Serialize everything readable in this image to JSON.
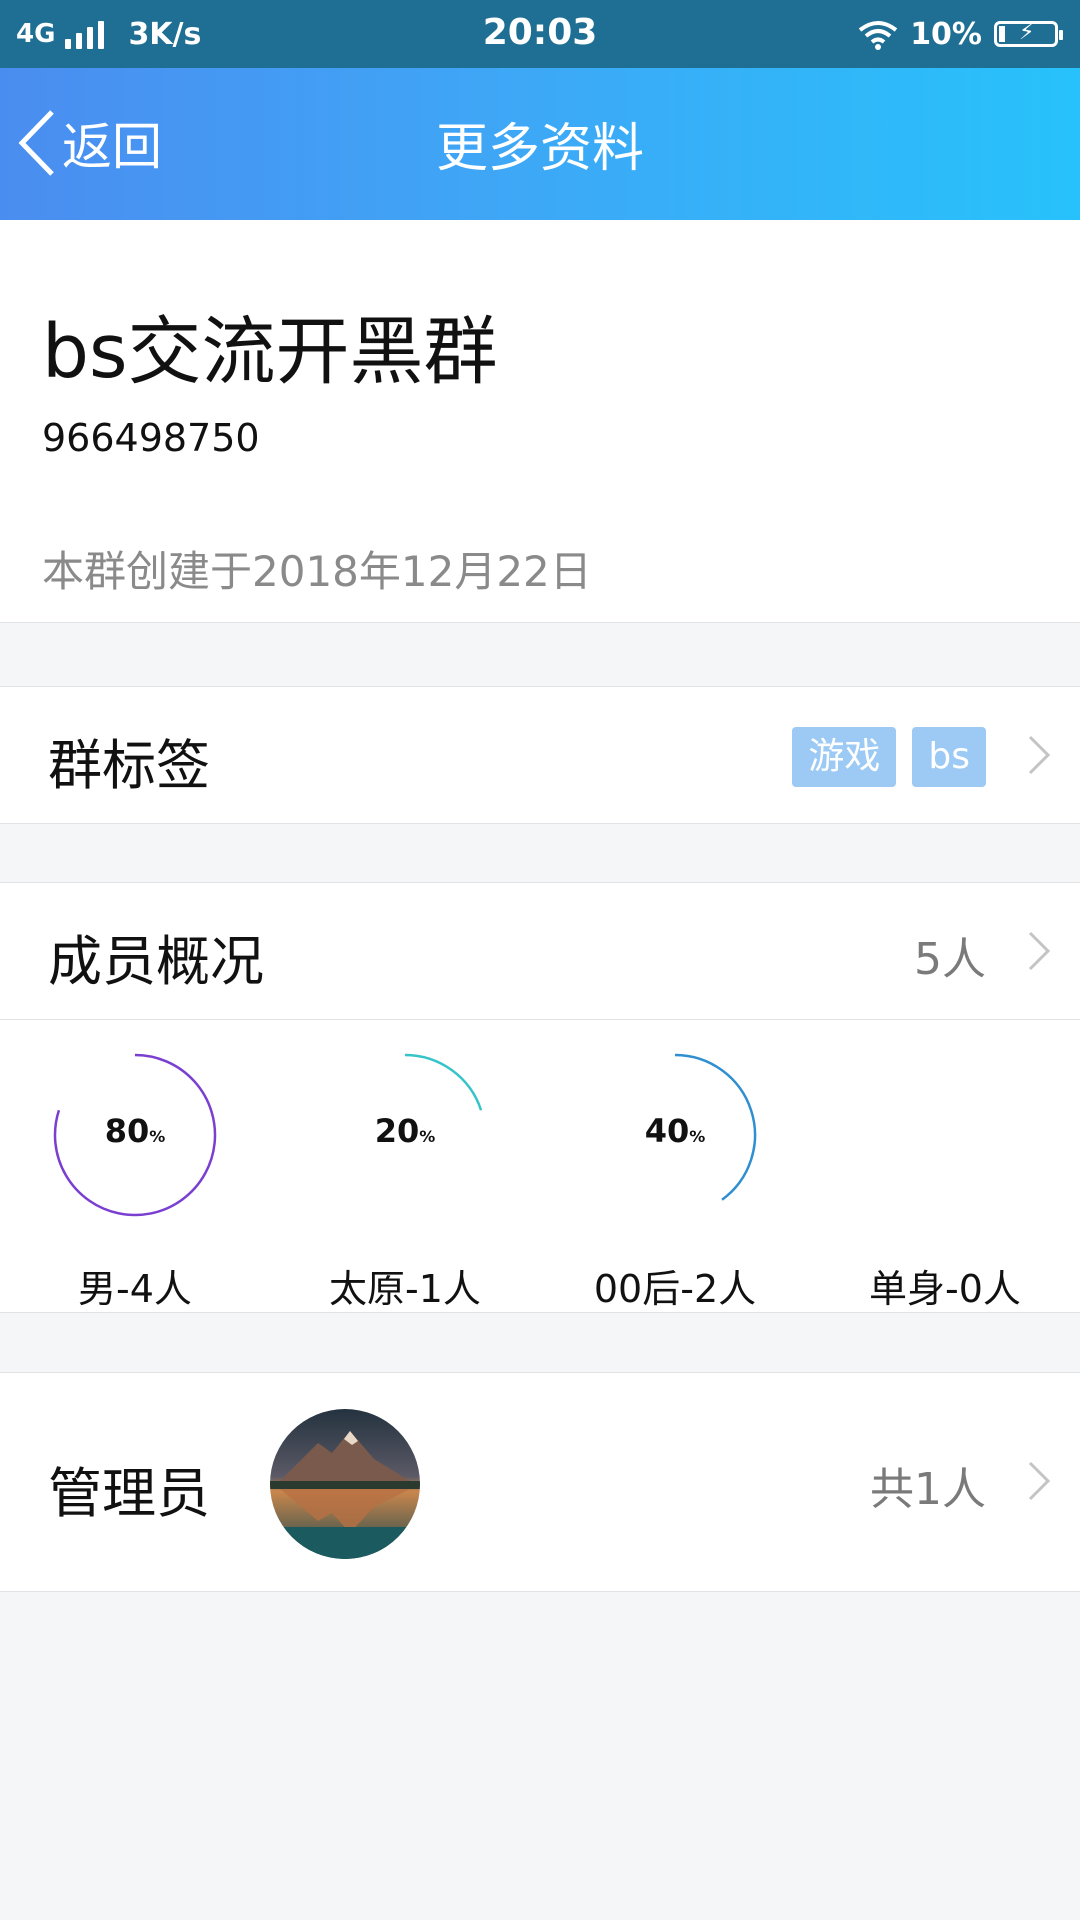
{
  "status_bar": {
    "network": "4G",
    "speed": "3K/s",
    "time": "20:03",
    "battery": "10%",
    "icons": [
      "signal-icon",
      "wifi-icon",
      "battery-charging-icon"
    ]
  },
  "nav": {
    "back_label": "返回",
    "title": "更多资料"
  },
  "group": {
    "name": "bs交流开黑群",
    "id": "966498750",
    "created": "本群创建于2018年12月22日"
  },
  "tags_row": {
    "label": "群标签",
    "tags": [
      "游戏",
      "bs"
    ]
  },
  "members_row": {
    "label": "成员概况",
    "value": "5人"
  },
  "stats": [
    {
      "pct": "80",
      "unit": "%",
      "label": "男-4人",
      "fraction": 0.8,
      "color": "#7a3fd0"
    },
    {
      "pct": "20",
      "unit": "%",
      "label": "太原-1人",
      "fraction": 0.2,
      "color": "#37c4c9"
    },
    {
      "pct": "40",
      "unit": "%",
      "label": "00后-2人",
      "fraction": 0.4,
      "color": "#2f8fd0"
    },
    {
      "pct": "",
      "unit": "",
      "label": "单身-0人",
      "fraction": 0,
      "color": "#cccccc"
    }
  ],
  "admin_row": {
    "label": "管理员",
    "value": "共1人"
  },
  "colors": {
    "nav_gradient_start": "#4a8df0",
    "nav_gradient_end": "#27c2fb",
    "tag_bg": "#9ccaf4",
    "page_bg": "#f5f6f8"
  }
}
